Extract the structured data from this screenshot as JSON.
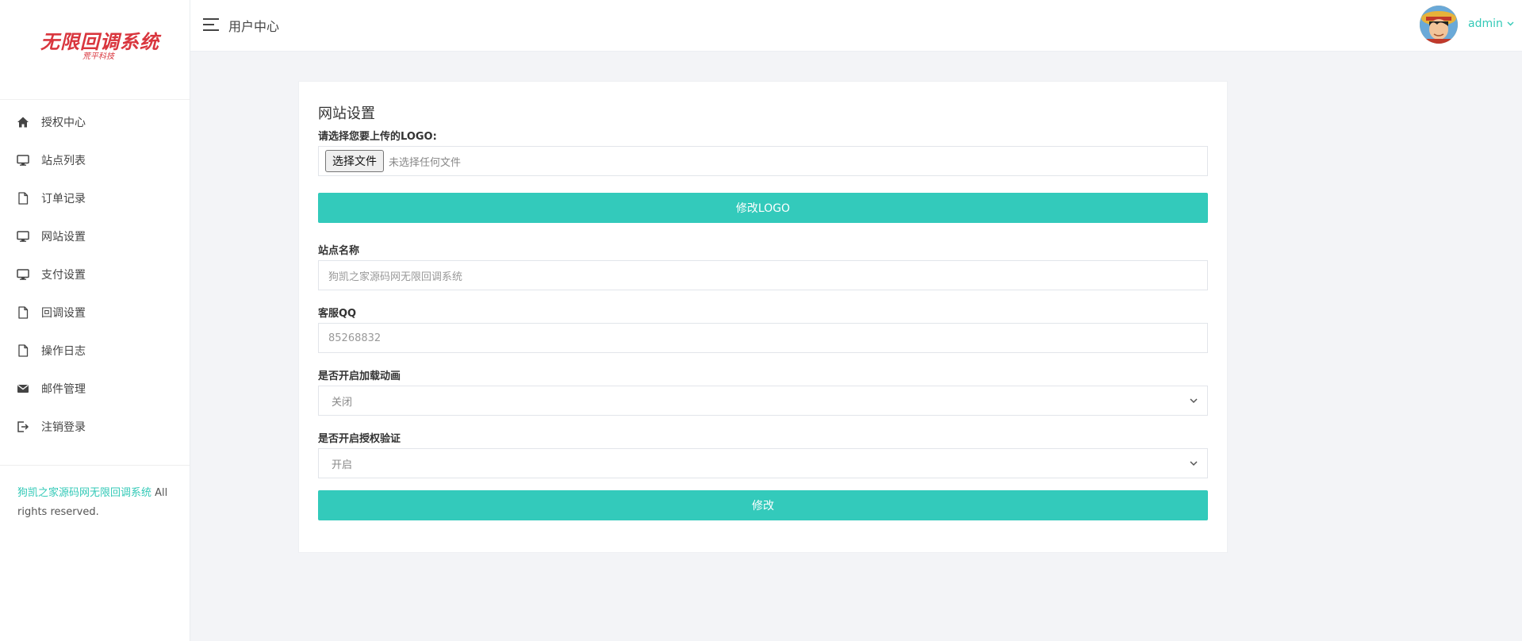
{
  "sidebar": {
    "logo_title": "无限回调系统",
    "logo_subtitle": "荒平科技",
    "items": [
      {
        "label": "授权中心",
        "icon": "home-icon"
      },
      {
        "label": "站点列表",
        "icon": "monitor-icon"
      },
      {
        "label": "订单记录",
        "icon": "file-icon"
      },
      {
        "label": "网站设置",
        "icon": "monitor-icon"
      },
      {
        "label": "支付设置",
        "icon": "monitor-icon"
      },
      {
        "label": "回调设置",
        "icon": "file-icon"
      },
      {
        "label": "操作日志",
        "icon": "file-icon"
      },
      {
        "label": "邮件管理",
        "icon": "envelope-icon"
      },
      {
        "label": "注销登录",
        "icon": "logout-icon"
      }
    ],
    "footer_link": "狗凯之家源码网无限回调系统",
    "footer_text": " All rights reserved."
  },
  "topbar": {
    "title": "用户中心",
    "user": "admin"
  },
  "form": {
    "title": "网站设置",
    "logo_label": "请选择您要上传的LOGO:",
    "file_button": "选择文件",
    "file_status": "未选择任何文件",
    "logo_button": "修改LOGO",
    "site_name_label": "站点名称",
    "site_name_placeholder": "狗凯之家源码网无限回调系统",
    "qq_label": "客服QQ",
    "qq_placeholder": "85268832",
    "loading_label": "是否开启加载动画",
    "loading_value": "关闭",
    "auth_label": "是否开启授权验证",
    "auth_value": "开启",
    "submit_button": "修改"
  },
  "colors": {
    "accent": "#33cabb",
    "logo_red": "#d9363e",
    "background": "#f3f4f7"
  }
}
